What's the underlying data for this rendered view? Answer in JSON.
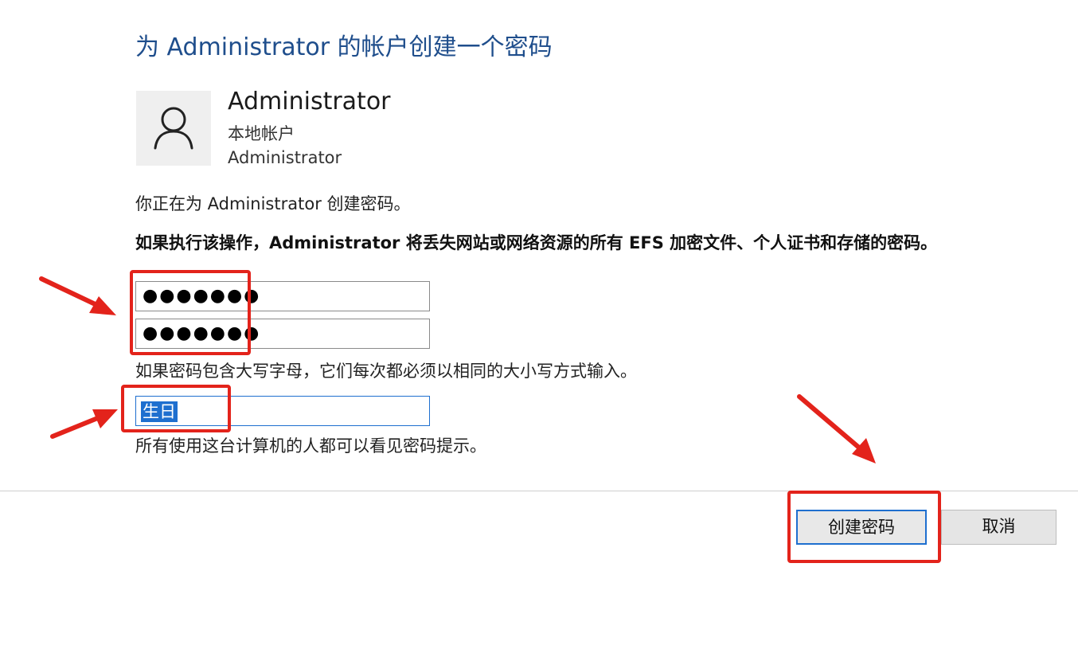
{
  "dialog": {
    "title": "为 Administrator 的帐户创建一个密码"
  },
  "account": {
    "name": "Administrator",
    "type": "本地帐户",
    "username": "Administrator"
  },
  "text": {
    "intro": "你正在为 Administrator 创建密码。",
    "warning": "如果执行该操作，Administrator 将丢失网站或网络资源的所有 EFS 加密文件、个人证书和存储的密码。",
    "case_note": "如果密码包含大写字母，它们每次都必须以相同的大小写方式输入。",
    "hint_note": "所有使用这台计算机的人都可以看见密码提示。"
  },
  "fields": {
    "new_password_value": "●●●●●●●",
    "confirm_password_value": "●●●●●●●",
    "hint_value": "生日"
  },
  "buttons": {
    "create_label": "创建密码",
    "cancel_label": "取消"
  },
  "colors": {
    "title": "#1f4e8c",
    "focus_blue": "#1e6fcf",
    "annotation_red": "#e3231b"
  },
  "icons": {
    "avatar": "user-icon",
    "annotation": "arrow-icon"
  }
}
